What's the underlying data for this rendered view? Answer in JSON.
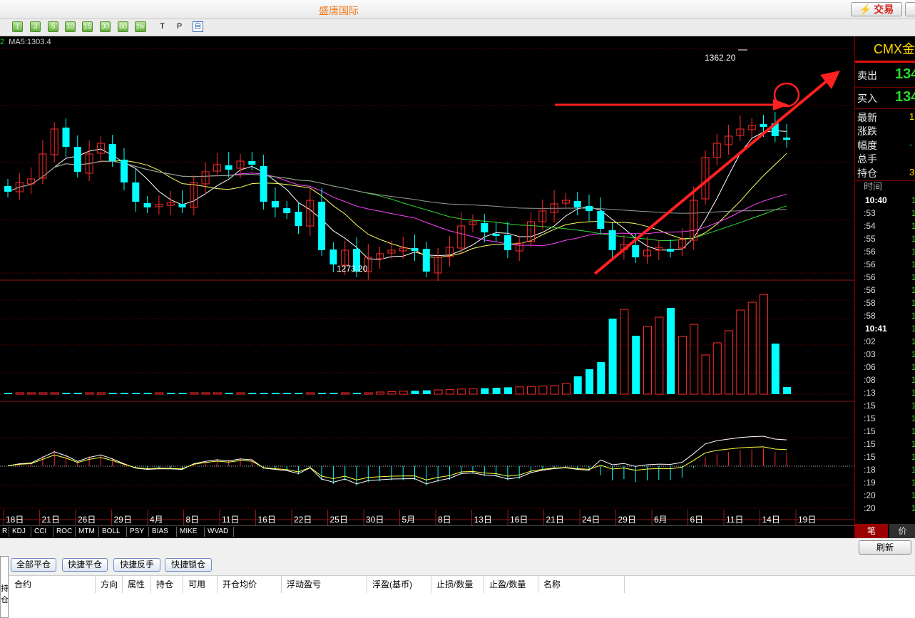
{
  "window": {
    "title": "盛唐国际",
    "trade_button": "交易"
  },
  "toolbar": {
    "periods": [
      "1",
      "3",
      "5",
      "10",
      "15",
      "30",
      "60",
      "2hr"
    ],
    "tools": [
      "T",
      "P"
    ],
    "auto": "自"
  },
  "ma_label": {
    "prefix": "2",
    "text": "MA5:1303.4"
  },
  "chart": {
    "high_label": "1362.20",
    "low_label": "1273.20",
    "x_labels": [
      "18日",
      "21日",
      "26日",
      "29日",
      "4月",
      "8日",
      "11日",
      "16日",
      "22日",
      "25日",
      "30日",
      "5月",
      "8日",
      "13日",
      "16日",
      "21日",
      "24日",
      "29日",
      "6月",
      "6日",
      "11日",
      "14日",
      "19日"
    ],
    "colors": {
      "up": "#ff2b2b",
      "down": "#00ffff",
      "ma5": "#ffffff",
      "ma10": "#ffff66",
      "ma20": "#ff40ff",
      "ma30": "#33dd33",
      "ma60": "#999999",
      "annotation": "#ff2020"
    }
  },
  "indicators": [
    "R",
    "KDJ",
    "CCI",
    "ROC",
    "MTM",
    "BOLL",
    "PSY",
    "BIAS",
    "MIKE",
    "WVAD"
  ],
  "quote": {
    "symbol": "CMX金",
    "sell_label": "卖出",
    "sell_price": "134",
    "buy_label": "买入",
    "buy_price": "134",
    "stats": [
      {
        "label": "最新",
        "value": "1"
      },
      {
        "label": "涨跌",
        "value": ""
      },
      {
        "label": "幅度",
        "value": "-"
      },
      {
        "label": "总手",
        "value": ""
      },
      {
        "label": "持仓",
        "value": "3"
      }
    ],
    "time_header": "时间",
    "ticks": [
      {
        "time": "10:40",
        "val": "1"
      },
      {
        "time": ":53",
        "val": "1"
      },
      {
        "time": ":54",
        "val": "1"
      },
      {
        "time": ":55",
        "val": "1"
      },
      {
        "time": ":56",
        "val": "1"
      },
      {
        "time": ":56",
        "val": "1"
      },
      {
        "time": ":56",
        "val": "1"
      },
      {
        "time": ":56",
        "val": "1"
      },
      {
        "time": ":58",
        "val": "1"
      },
      {
        "time": ":58",
        "val": "1"
      },
      {
        "time": "10:41",
        "val": "1"
      },
      {
        "time": ":02",
        "val": "1"
      },
      {
        "time": ":03",
        "val": "1"
      },
      {
        "time": ":06",
        "val": "1"
      },
      {
        "time": ":08",
        "val": "1"
      },
      {
        "time": ":13",
        "val": "1"
      },
      {
        "time": ":15",
        "val": "1"
      },
      {
        "time": ":15",
        "val": "1"
      },
      {
        "time": ":15",
        "val": "1"
      },
      {
        "time": ":15",
        "val": "1"
      },
      {
        "time": ":15",
        "val": "1"
      },
      {
        "time": ":18",
        "val": "1"
      },
      {
        "time": ":19",
        "val": "1"
      },
      {
        "time": ":20",
        "val": "1"
      },
      {
        "time": ":20",
        "val": "1"
      }
    ],
    "tab_pen": "笔",
    "tab_price": "价"
  },
  "positions": {
    "side_tab": "持仓",
    "refresh": "刷新",
    "buttons": [
      "全部平仓",
      "快捷平仓",
      "快捷反手",
      "快捷锁仓"
    ],
    "columns": [
      "合约",
      "方向",
      "属性",
      "持仓",
      "可用",
      "开仓均价",
      "浮动盈亏",
      "浮盈(基币)",
      "止损/数量",
      "止盈/数量",
      "名称"
    ]
  }
}
